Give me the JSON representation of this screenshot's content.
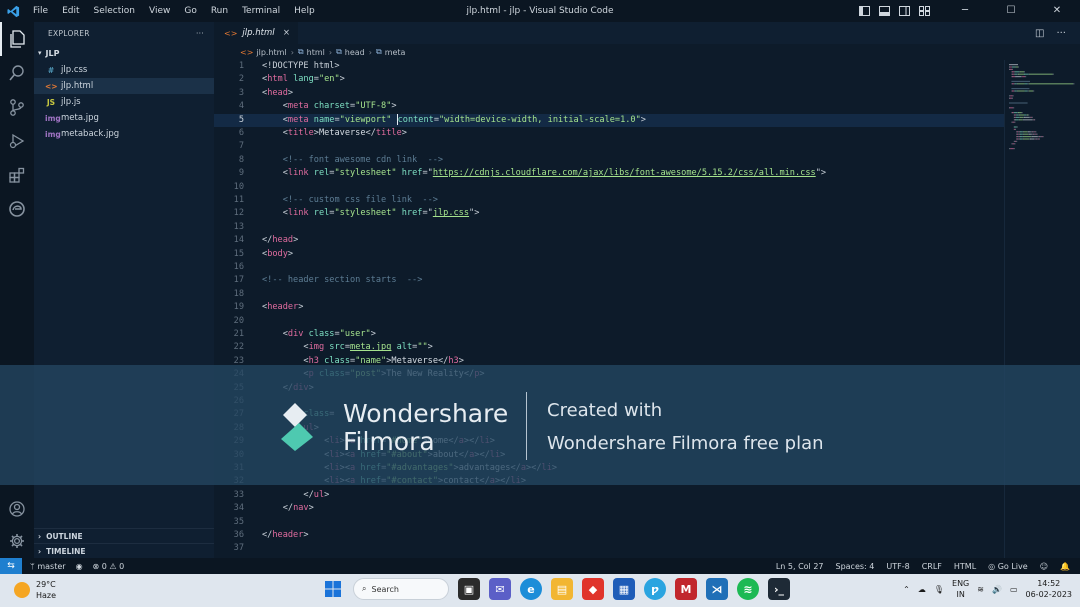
{
  "window": {
    "title": "jlp.html - jlp - Visual Studio Code",
    "menu": [
      "File",
      "Edit",
      "Selection",
      "View",
      "Go",
      "Run",
      "Terminal",
      "Help"
    ]
  },
  "sidebar": {
    "title": "EXPLORER",
    "more": "···",
    "folder": "JLP",
    "files": [
      {
        "name": "jlp.css",
        "icon": "#",
        "icon_color": "#519aba"
      },
      {
        "name": "jlp.html",
        "icon": "<>",
        "icon_color": "#e37933",
        "selected": true
      },
      {
        "name": "jlp.js",
        "icon": "JS",
        "icon_color": "#cbcb41"
      },
      {
        "name": "meta.jpg",
        "icon": "img",
        "icon_color": "#a074c4"
      },
      {
        "name": "metaback.jpg",
        "icon": "img",
        "icon_color": "#a074c4"
      }
    ],
    "sections": [
      "OUTLINE",
      "TIMELINE"
    ]
  },
  "editor": {
    "tab": {
      "label": "jlp.html",
      "close": "×"
    },
    "breadcrumb": [
      "jlp.html",
      "html",
      "head",
      "meta"
    ],
    "lines": [
      [
        [
          "d",
          "<!DOCTYPE html>"
        ]
      ],
      [
        [
          "b",
          "<"
        ],
        [
          "t",
          "html"
        ],
        [
          "a",
          " lang"
        ],
        [
          "b",
          "="
        ],
        [
          "v",
          "\"en\""
        ],
        [
          "b",
          ">"
        ]
      ],
      [
        [
          "b",
          "<"
        ],
        [
          "t",
          "head"
        ],
        [
          "b",
          ">"
        ]
      ],
      [
        [
          "x",
          "    "
        ],
        [
          "b",
          "<"
        ],
        [
          "t",
          "meta"
        ],
        [
          "a",
          " charset"
        ],
        [
          "b",
          "="
        ],
        [
          "v",
          "\"UTF-8\""
        ],
        [
          "b",
          ">"
        ]
      ],
      [
        [
          "x",
          "    "
        ],
        [
          "b",
          "<"
        ],
        [
          "t",
          "meta"
        ],
        [
          "a",
          " name"
        ],
        [
          "b",
          "="
        ],
        [
          "v",
          "\"viewport\""
        ],
        [
          "a",
          " "
        ],
        [
          "c",
          ""
        ],
        [
          "a",
          "content"
        ],
        [
          "b",
          "="
        ],
        [
          "v",
          "\"width=device-width, initial-scale=1.0\""
        ],
        [
          "b",
          ">"
        ]
      ],
      [
        [
          "x",
          "    "
        ],
        [
          "b",
          "<"
        ],
        [
          "t",
          "title"
        ],
        [
          "b",
          ">"
        ],
        [
          "x",
          "Metaverse"
        ],
        [
          "b",
          "</"
        ],
        [
          "t",
          "title"
        ],
        [
          "b",
          ">"
        ]
      ],
      [],
      [
        [
          "x",
          "    "
        ],
        [
          "m",
          "<!-- font awesome cdn link  -->"
        ]
      ],
      [
        [
          "x",
          "    "
        ],
        [
          "b",
          "<"
        ],
        [
          "t",
          "link"
        ],
        [
          "a",
          " rel"
        ],
        [
          "b",
          "="
        ],
        [
          "v",
          "\"stylesheet\""
        ],
        [
          "a",
          " href"
        ],
        [
          "b",
          "=\""
        ],
        [
          "u",
          "https://cdnjs.cloudflare.com/ajax/libs/font-awesome/5.15.2/css/all.min.css"
        ],
        [
          "b",
          "\">"
        ]
      ],
      [],
      [
        [
          "x",
          "    "
        ],
        [
          "m",
          "<!-- custom css file link  -->"
        ]
      ],
      [
        [
          "x",
          "    "
        ],
        [
          "b",
          "<"
        ],
        [
          "t",
          "link"
        ],
        [
          "a",
          " rel"
        ],
        [
          "b",
          "="
        ],
        [
          "v",
          "\"stylesheet\""
        ],
        [
          "a",
          " href"
        ],
        [
          "b",
          "=\""
        ],
        [
          "u",
          "jlp.css"
        ],
        [
          "b",
          "\">"
        ]
      ],
      [],
      [
        [
          "b",
          "</"
        ],
        [
          "t",
          "head"
        ],
        [
          "b",
          ">"
        ]
      ],
      [
        [
          "b",
          "<"
        ],
        [
          "t",
          "body"
        ],
        [
          "b",
          ">"
        ]
      ],
      [],
      [
        [
          "m",
          "<!-- header section starts  -->"
        ]
      ],
      [],
      [
        [
          "b",
          "<"
        ],
        [
          "t",
          "header"
        ],
        [
          "b",
          ">"
        ]
      ],
      [],
      [
        [
          "x",
          "    "
        ],
        [
          "b",
          "<"
        ],
        [
          "t",
          "div"
        ],
        [
          "a",
          " class"
        ],
        [
          "b",
          "="
        ],
        [
          "v",
          "\"user\""
        ],
        [
          "b",
          ">"
        ]
      ],
      [
        [
          "x",
          "        "
        ],
        [
          "b",
          "<"
        ],
        [
          "t",
          "img"
        ],
        [
          "a",
          " src"
        ],
        [
          "b",
          "="
        ],
        [
          "u",
          "meta.jpg"
        ],
        [
          "a",
          " alt"
        ],
        [
          "b",
          "="
        ],
        [
          "v",
          "\"\""
        ],
        [
          "b",
          ">"
        ]
      ],
      [
        [
          "x",
          "        "
        ],
        [
          "b",
          "<"
        ],
        [
          "t",
          "h3"
        ],
        [
          "a",
          " class"
        ],
        [
          "b",
          "="
        ],
        [
          "v",
          "\"name\""
        ],
        [
          "b",
          ">"
        ],
        [
          "x",
          "Metaverse"
        ],
        [
          "b",
          "</"
        ],
        [
          "t",
          "h3"
        ],
        [
          "b",
          ">"
        ]
      ],
      [
        [
          "x",
          "        "
        ],
        [
          "b",
          "<"
        ],
        [
          "t",
          "p"
        ],
        [
          "a",
          " class"
        ],
        [
          "b",
          "="
        ],
        [
          "v",
          "\"post\""
        ],
        [
          "b",
          ">"
        ],
        [
          "x",
          "The New Reality"
        ],
        [
          "b",
          "</"
        ],
        [
          "t",
          "p"
        ],
        [
          "b",
          ">"
        ]
      ],
      [
        [
          "x",
          "    "
        ],
        [
          "b",
          "</"
        ],
        [
          "t",
          "div"
        ],
        [
          "b",
          ">"
        ]
      ],
      [],
      [
        [
          "x",
          "        "
        ],
        [
          "a",
          "class"
        ],
        [
          "b",
          "="
        ]
      ],
      [
        [
          "x",
          "        "
        ],
        [
          "t",
          "ul"
        ],
        [
          "b",
          ">"
        ]
      ],
      [
        [
          "x",
          "            "
        ],
        [
          "b",
          "<"
        ],
        [
          "t",
          "li"
        ],
        [
          "b",
          "><"
        ],
        [
          "t",
          "a"
        ],
        [
          "a",
          " href"
        ],
        [
          "b",
          "="
        ],
        [
          "v",
          "\"#home\""
        ],
        [
          "b",
          ">"
        ],
        [
          "x",
          "home"
        ],
        [
          "b",
          "</"
        ],
        [
          "t",
          "a"
        ],
        [
          "b",
          "></"
        ],
        [
          "t",
          "li"
        ],
        [
          "b",
          ">"
        ]
      ],
      [
        [
          "x",
          "            "
        ],
        [
          "b",
          "<"
        ],
        [
          "t",
          "li"
        ],
        [
          "b",
          "><"
        ],
        [
          "t",
          "a"
        ],
        [
          "a",
          " href"
        ],
        [
          "b",
          "="
        ],
        [
          "v",
          "\"#about\""
        ],
        [
          "b",
          ">"
        ],
        [
          "x",
          "about"
        ],
        [
          "b",
          "</"
        ],
        [
          "t",
          "a"
        ],
        [
          "b",
          "></"
        ],
        [
          "t",
          "li"
        ],
        [
          "b",
          ">"
        ]
      ],
      [
        [
          "x",
          "            "
        ],
        [
          "b",
          "<"
        ],
        [
          "t",
          "li"
        ],
        [
          "b",
          "><"
        ],
        [
          "t",
          "a"
        ],
        [
          "a",
          " href"
        ],
        [
          "b",
          "="
        ],
        [
          "v",
          "\"#advantages\""
        ],
        [
          "b",
          ">"
        ],
        [
          "x",
          "advantages"
        ],
        [
          "b",
          "</"
        ],
        [
          "t",
          "a"
        ],
        [
          "b",
          "></"
        ],
        [
          "t",
          "li"
        ],
        [
          "b",
          ">"
        ]
      ],
      [
        [
          "x",
          "            "
        ],
        [
          "b",
          "<"
        ],
        [
          "t",
          "li"
        ],
        [
          "b",
          "><"
        ],
        [
          "t",
          "a"
        ],
        [
          "a",
          " href"
        ],
        [
          "b",
          "="
        ],
        [
          "v",
          "\"#contact\""
        ],
        [
          "b",
          ">"
        ],
        [
          "x",
          "contact"
        ],
        [
          "b",
          "</"
        ],
        [
          "t",
          "a"
        ],
        [
          "b",
          "></"
        ],
        [
          "t",
          "li"
        ],
        [
          "b",
          ">"
        ]
      ],
      [
        [
          "x",
          "        "
        ],
        [
          "b",
          "</"
        ],
        [
          "t",
          "ul"
        ],
        [
          "b",
          ">"
        ]
      ],
      [
        [
          "x",
          "    "
        ],
        [
          "b",
          "</"
        ],
        [
          "t",
          "nav"
        ],
        [
          "b",
          ">"
        ]
      ],
      [],
      [
        [
          "b",
          "</"
        ],
        [
          "t",
          "header"
        ],
        [
          "b",
          ">"
        ]
      ],
      []
    ],
    "current_line": 5
  },
  "watermark": {
    "brand_line1": "Wondershare",
    "brand_line2": "Filmora",
    "text_line1": "Created with",
    "text_line2": "Wondershare Filmora free plan"
  },
  "statusbar": {
    "branch": "master",
    "problems": "⊗ 0 ⚠ 0",
    "position": "Ln 5, Col 27",
    "spaces": "Spaces: 4",
    "encoding": "UTF-8",
    "eol": "CRLF",
    "language": "HTML",
    "golive": "Go Live"
  },
  "taskbar": {
    "temp": "29°C",
    "weather": "Haze",
    "search": "Search",
    "lang1": "ENG",
    "lang2": "IN",
    "time": "14:52",
    "date": "06-02-2023"
  },
  "colors": {
    "accent": "#1f7fcf",
    "editor_bg": "#0d1b2a"
  }
}
